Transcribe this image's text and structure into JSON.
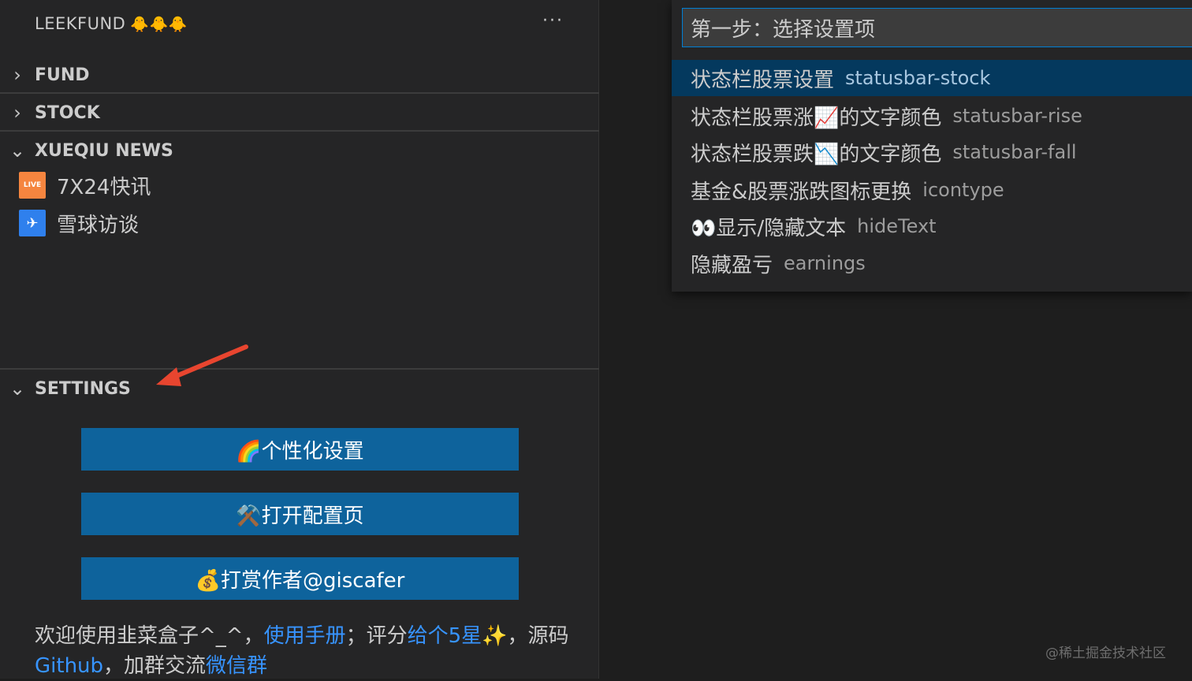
{
  "sidebar": {
    "title": "LEEKFUND",
    "title_emoji": "🐥🐥🐥",
    "more_label": "···",
    "sections": [
      {
        "label": "FUND",
        "expanded": false
      },
      {
        "label": "STOCK",
        "expanded": false
      },
      {
        "label": "XUEQIU NEWS",
        "expanded": true
      },
      {
        "label": "SETTINGS",
        "expanded": true
      }
    ],
    "news_items": [
      {
        "label": "7X24快讯",
        "icon_text": "LIVE",
        "icon_color": "#f5853f"
      },
      {
        "label": "雪球访谈",
        "icon_text": "✈",
        "icon_color": "#2f80ed"
      }
    ],
    "buttons": [
      "🌈个性化设置",
      "⚒️打开配置页",
      "💰打赏作者@giscafer"
    ],
    "footer": {
      "t1": "欢迎使用韭菜盒子^_^，",
      "l1": "使用手册",
      "t2": "；评分",
      "l2": "给个5星✨",
      "t3": "，源码",
      "l3": "Github",
      "t4": "，加群交流",
      "l4": "微信群"
    }
  },
  "quickpick": {
    "input_value": "第一步：选择设置项",
    "items": [
      {
        "label": "状态栏股票设置",
        "desc": "statusbar-stock",
        "selected": true
      },
      {
        "label": "状态栏股票涨📈的文字颜色",
        "desc": "statusbar-rise",
        "selected": false
      },
      {
        "label": "状态栏股票跌📉的文字颜色",
        "desc": "statusbar-fall",
        "selected": false
      },
      {
        "label": "基金&股票涨跌图标更换",
        "desc": "icontype",
        "selected": false
      },
      {
        "label": "👀显示/隐藏文本",
        "desc": "hideText",
        "selected": false
      },
      {
        "label": "隐藏盈亏",
        "desc": "earnings",
        "selected": false
      }
    ]
  },
  "watermark": "@稀土掘金技术社区",
  "colors": {
    "button_bg": "#0e639c",
    "link": "#3794ff",
    "selected_bg": "#04395e",
    "arrow": "#e8452f"
  }
}
